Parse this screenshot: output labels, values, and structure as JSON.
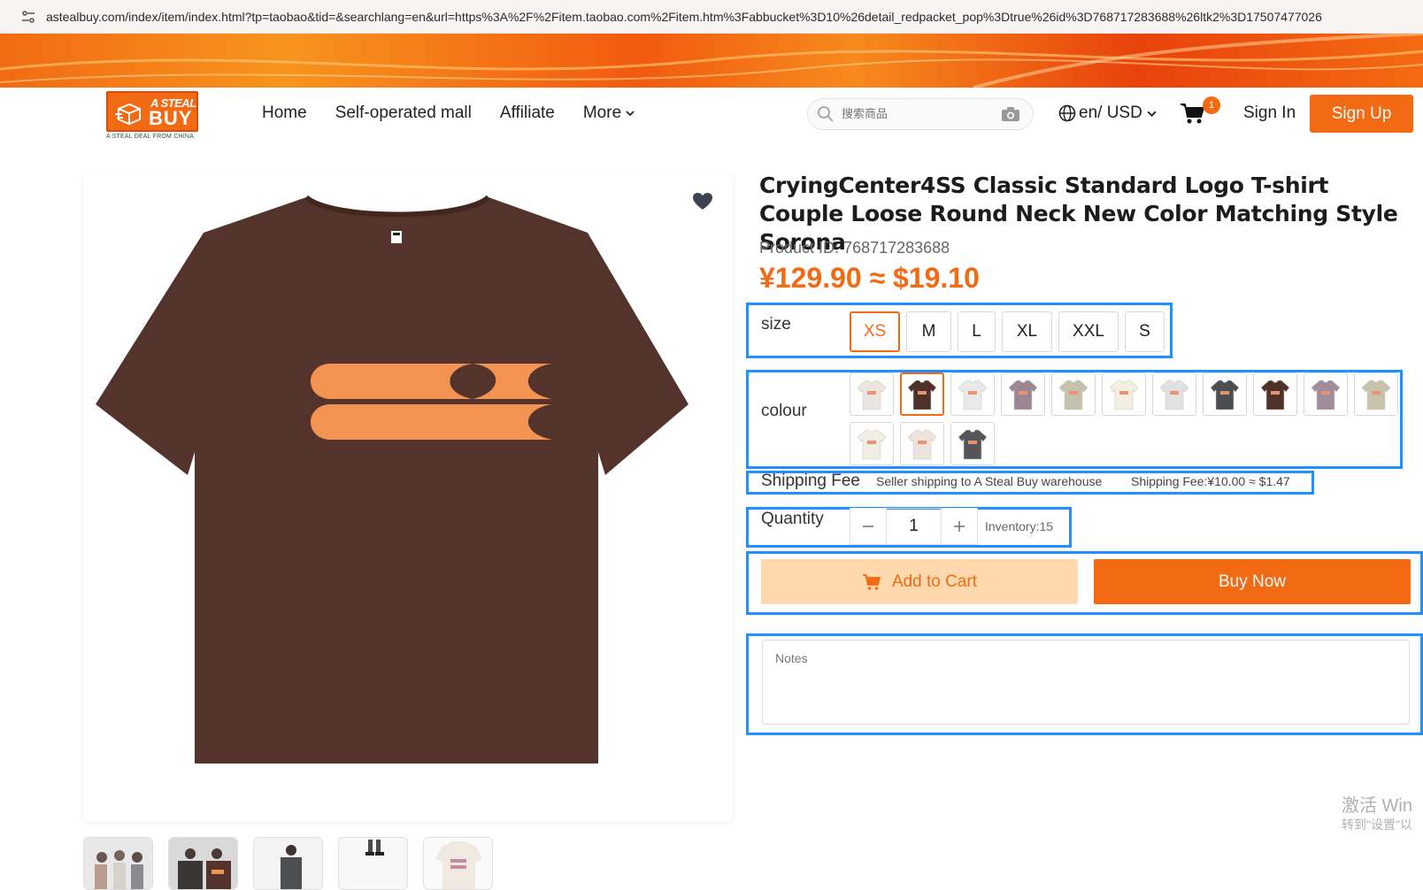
{
  "browser": {
    "url": "astealbuy.com/index/item/index.html?tp=taobao&tid=&searchlang=en&url=https%3A%2F%2Fitem.taobao.com%2Fitem.htm%3Fabbucket%3D10%26detail_redpacket_pop%3Dtrue%26id%3D768717283688%26ltk2%3D17507477026"
  },
  "header": {
    "logo_line1": "A STEAL",
    "logo_line2": "BUY",
    "logo_tagline": "A STEAL DEAL FROM CHINA",
    "nav": [
      "Home",
      "Self-operated mall",
      "Affiliate",
      "More"
    ],
    "search_placeholder": "搜索商品",
    "lang_currency": "en/ USD",
    "cart_count": "1",
    "sign_in": "Sign In",
    "sign_up": "Sign Up"
  },
  "product": {
    "title": "CryingCenter4SS Classic Standard Logo T-shirt Couple Loose Round Neck New Color Matching Style Sorona",
    "id_label": "Product ID:",
    "id_value": "768717283688",
    "price": "¥129.90 ≈ $19.10",
    "size_label": "size",
    "sizes": [
      "XS",
      "M",
      "L",
      "XL",
      "XXL",
      "S"
    ],
    "selected_size": "XS",
    "colour_label": "colour",
    "colours": [
      "#ece5df",
      "#4e3129",
      "#e9e9e9",
      "#9a8694",
      "#c4c1ac",
      "#f3efe3",
      "#e1e1e1",
      "#4a4d52",
      "#4e3129",
      "#a18c9b",
      "#c7c2ab",
      "#f1eee4",
      "#ece3dc",
      "#545558"
    ],
    "selected_colour_index": 1,
    "shipping_label": "Shipping Fee",
    "shipping_text": "Seller shipping to A Steal Buy warehouse",
    "shipping_fee": "Shipping Fee:¥10.00 ≈ $1.47",
    "quantity_label": "Quantity",
    "quantity_value": "1",
    "inventory": "Inventory:15",
    "add_to_cart": "Add to Cart",
    "buy_now": "Buy Now",
    "notes_placeholder": "Notes"
  },
  "colors": {
    "accent": "#f26a13",
    "highlight": "#1e90ff",
    "shirt": "#53332b",
    "shirt_print": "#f39352"
  },
  "os_watermark": {
    "line1": "激活 Win",
    "line2": "转到\"设置\"以"
  }
}
